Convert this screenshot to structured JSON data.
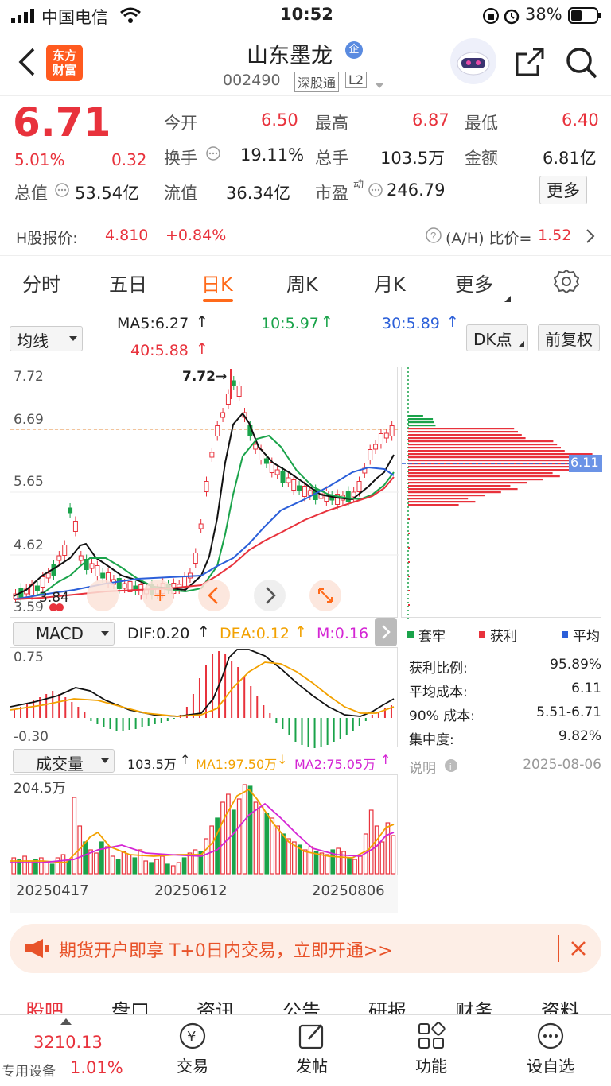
{
  "status": {
    "carrier": "中国电信",
    "time": "10:52",
    "battery": "38%"
  },
  "header": {
    "stock_name": "山东墨龙",
    "stock_code": "002490",
    "exchange_tag": "深股通",
    "level_tag": "L2",
    "logo_text": "东方\n财富"
  },
  "quote": {
    "price": "6.71",
    "change_pct": "5.01%",
    "change": "0.32",
    "open_label": "今开",
    "open": "6.50",
    "high_label": "最高",
    "high": "6.87",
    "low_label": "最低",
    "low": "6.40",
    "turnover_label": "换手",
    "turnover": "19.11%",
    "volume_label": "总手",
    "volume": "103.5万",
    "amount_label": "金额",
    "amount": "6.81亿",
    "mktcap_label": "总值",
    "mktcap": "53.54亿",
    "float_label": "流值",
    "float": "36.34亿",
    "pe_label": "市盈",
    "pe_sup": "动",
    "pe": "246.79",
    "more_btn": "更多"
  },
  "hshare": {
    "label": "H股报价:",
    "price": "4.810",
    "change": "+0.84%",
    "ah_label": "(A/H) 比价=",
    "ah_value": "1.52"
  },
  "tabs": [
    "分时",
    "五日",
    "日K",
    "周K",
    "月K",
    "更多"
  ],
  "active_tab": "日K",
  "ma": {
    "selector": "均线",
    "ma5": "MA5:6.27",
    "ma10": "10:5.97",
    "ma30": "30:5.89",
    "ma40": "40:5.88",
    "dk_btn": "DK点",
    "adjust_btn": "前复权"
  },
  "kchart": {
    "y_labels": [
      "7.72",
      "6.69",
      "5.65",
      "4.62",
      "3.59"
    ],
    "peak_label": "7.72→",
    "low_label": "3.84",
    "cost_marker": "6.11"
  },
  "macd": {
    "selector": "MACD",
    "dif": "DIF:0.20",
    "dea": "DEA:0.12",
    "m": "M:0.16",
    "y_top": "0.75",
    "y_bot": "-0.30"
  },
  "vol": {
    "selector": "成交量",
    "value": "103.5万",
    "ma1": "MA1:97.50万",
    "ma2": "MA2:75.05万",
    "y_top": "204.5万"
  },
  "x_labels": [
    "20250417",
    "20250612",
    "20250806"
  ],
  "cost": {
    "legend": [
      "套牢",
      "获利",
      "平均"
    ],
    "rows": [
      {
        "label": "获利比例:",
        "value": "95.89%"
      },
      {
        "label": "平均成本:",
        "value": "6.11"
      },
      {
        "label": "90% 成本:",
        "value": "5.51-6.71"
      },
      {
        "label": "集中度:",
        "value": "9.82%"
      }
    ],
    "note_label": "说明",
    "date": "2025-08-06"
  },
  "promo": {
    "text": "期货开户即享 T+0日内交易，立即开通>>"
  },
  "bottom_tabs": [
    "股吧",
    "盘口",
    "资讯",
    "公告",
    "研报",
    "财务",
    "资料"
  ],
  "nav": {
    "index_value": "3210.13",
    "index_label": "专用设备",
    "index_change": "1.01%",
    "items": [
      "交易",
      "发帖",
      "功能",
      "设自选"
    ]
  },
  "colors": {
    "up": "#e8323c",
    "down": "#1aa34a",
    "ma10": "#1aa34a",
    "ma30": "#2b5fd9",
    "ma40": "#e8323c",
    "accent": "#ff6a1a"
  }
}
